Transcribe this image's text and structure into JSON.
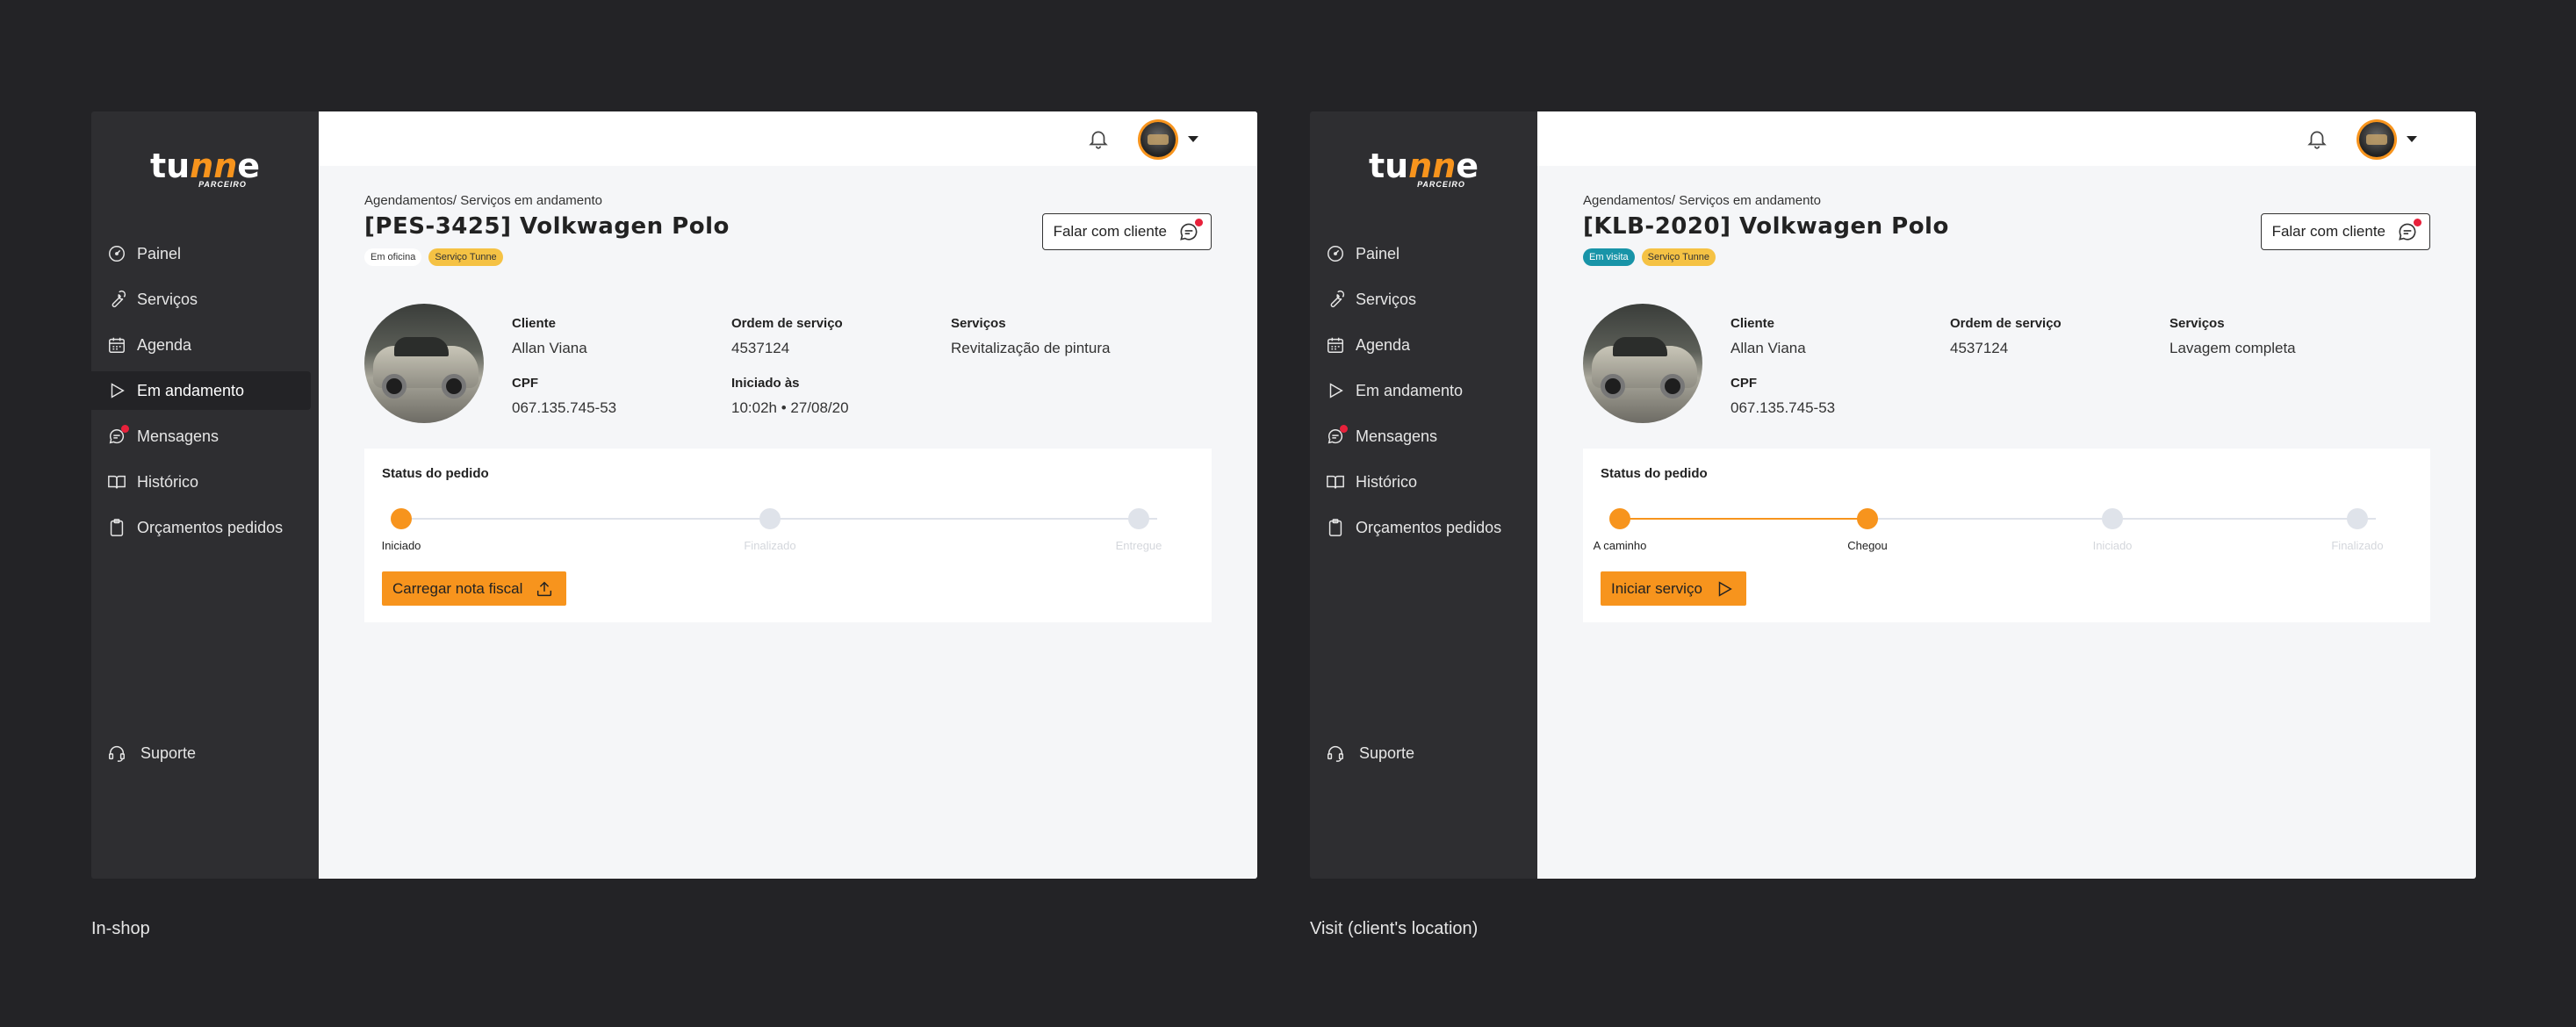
{
  "colors": {
    "accent": "#f7941d",
    "sidebar": "#2e2e31",
    "background": "#232326",
    "badge_red": "#e8213b",
    "tag_yellow": "#f5c244",
    "tag_teal": "#1894a8"
  },
  "logo": {
    "word_a": "tu",
    "word_b": "nn",
    "word_c": "e",
    "sub": "PARCEIRO"
  },
  "nav": [
    {
      "label": "Painel",
      "icon": "gauge-icon"
    },
    {
      "label": "Serviços",
      "icon": "wrench-icon"
    },
    {
      "label": "Agenda",
      "icon": "calendar-icon"
    },
    {
      "label": "Em andamento",
      "icon": "play-icon"
    },
    {
      "label": "Mensagens",
      "icon": "chat-icon"
    },
    {
      "label": "Histórico",
      "icon": "book-icon"
    },
    {
      "label": "Orçamentos pedidos",
      "icon": "clipboard-icon"
    }
  ],
  "support_label": "Suporte",
  "screens": [
    {
      "breadcrumb": "Agendamentos/ Serviços em andamento",
      "title": "[PES-3425] Volkwagen Polo",
      "tags": [
        "Em oficina",
        "Serviço Tunne"
      ],
      "talk_label": "Falar com cliente",
      "fields": {
        "client_lbl": "Cliente",
        "client_val": "Allan Viana",
        "os_lbl": "Ordem de serviço",
        "os_val": "4537124",
        "services_lbl": "Serviços",
        "services_val": "Revitalização de pintura",
        "cpf_lbl": "CPF",
        "cpf_val": "067.135.745-53",
        "started_lbl": "Iniciado às",
        "started_val": "10:02h • 27/08/20"
      },
      "status_title": "Status do pedido",
      "steps": [
        {
          "label": "Iniciado",
          "done": true
        },
        {
          "label": "Finalizado",
          "done": false
        },
        {
          "label": "Entregue",
          "done": false
        }
      ],
      "action_label": "Carregar nota fiscal",
      "caption": "In-shop"
    },
    {
      "breadcrumb": "Agendamentos/ Serviços em andamento",
      "title": "[KLB-2020] Volkwagen Polo",
      "tags": [
        "Em visita",
        "Serviço Tunne"
      ],
      "talk_label": "Falar com cliente",
      "fields": {
        "client_lbl": "Cliente",
        "client_val": "Allan Viana",
        "os_lbl": "Ordem de serviço",
        "os_val": "4537124",
        "services_lbl": "Serviços",
        "services_val": "Lavagem completa",
        "cpf_lbl": "CPF",
        "cpf_val": "067.135.745-53"
      },
      "status_title": "Status do pedido",
      "steps": [
        {
          "label": "A caminho",
          "done": true
        },
        {
          "label": "Chegou",
          "done": true
        },
        {
          "label": "Iniciado",
          "done": false
        },
        {
          "label": "Finalizado",
          "done": false
        }
      ],
      "action_label": "Iniciar serviço",
      "caption": "Visit (client's location)"
    }
  ]
}
